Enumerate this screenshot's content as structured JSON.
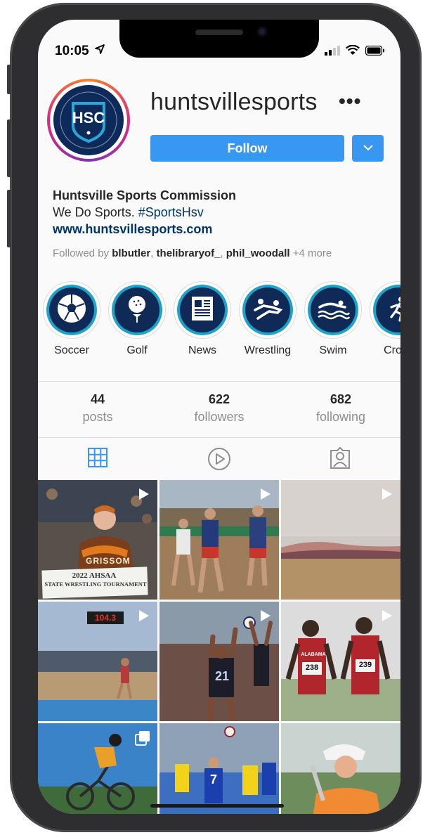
{
  "status_bar": {
    "time": "10:05"
  },
  "profile": {
    "username": "huntsvillesports",
    "avatar_text": "HSC",
    "follow_label": "Follow",
    "name": "Huntsville Sports Commission",
    "bio_text": "We Do Sports. ",
    "bio_hashtag": "#SportsHsv",
    "website": "www.huntsvillesports.com",
    "followed_by_prefix": "Followed by ",
    "followed_by": [
      "blbutler",
      "thelibraryof_",
      "phil_woodall"
    ],
    "followed_by_more": "+4 more"
  },
  "highlights": [
    {
      "label": "Soccer",
      "icon": "soccer-ball-icon"
    },
    {
      "label": "Golf",
      "icon": "golf-ball-icon"
    },
    {
      "label": "News",
      "icon": "newspaper-icon"
    },
    {
      "label": "Wrestling",
      "icon": "wrestling-icon"
    },
    {
      "label": "Swim",
      "icon": "swimmer-icon"
    },
    {
      "label": "Cross",
      "icon": "runner-icon"
    }
  ],
  "stats": {
    "posts": {
      "value": "44",
      "label": "posts"
    },
    "followers": {
      "value": "622",
      "label": "followers"
    },
    "following": {
      "value": "682",
      "label": "following"
    }
  },
  "tabs": [
    {
      "name": "grid",
      "icon": "grid-icon",
      "active": true
    },
    {
      "name": "reels",
      "icon": "play-icon",
      "active": false
    },
    {
      "name": "tagged",
      "icon": "tagged-person-icon",
      "active": false
    }
  ],
  "posts": [
    {
      "caption_line1": "2022 AHSAA",
      "caption_line2": "STATE WRESTLING TOURNAMENT",
      "jersey_text": "GRISSOM",
      "badge": "video-icon"
    },
    {
      "badge": "video-icon"
    },
    {
      "badge": "video-icon"
    },
    {
      "banner_text": "104.3",
      "badge": "video-icon"
    },
    {
      "jersey_number": "21",
      "badge": "video-icon"
    },
    {
      "jersey_text": "ALABAMA",
      "bib1": "238",
      "bib2": "239",
      "badge": "video-icon"
    },
    {
      "badge": "carousel-icon"
    },
    {
      "jersey_number": "7"
    },
    {}
  ],
  "colors": {
    "accent": "#3897f0",
    "link": "#003569",
    "highlight_ring": "#1ba3c9",
    "highlight_core": "#0f2a57"
  }
}
